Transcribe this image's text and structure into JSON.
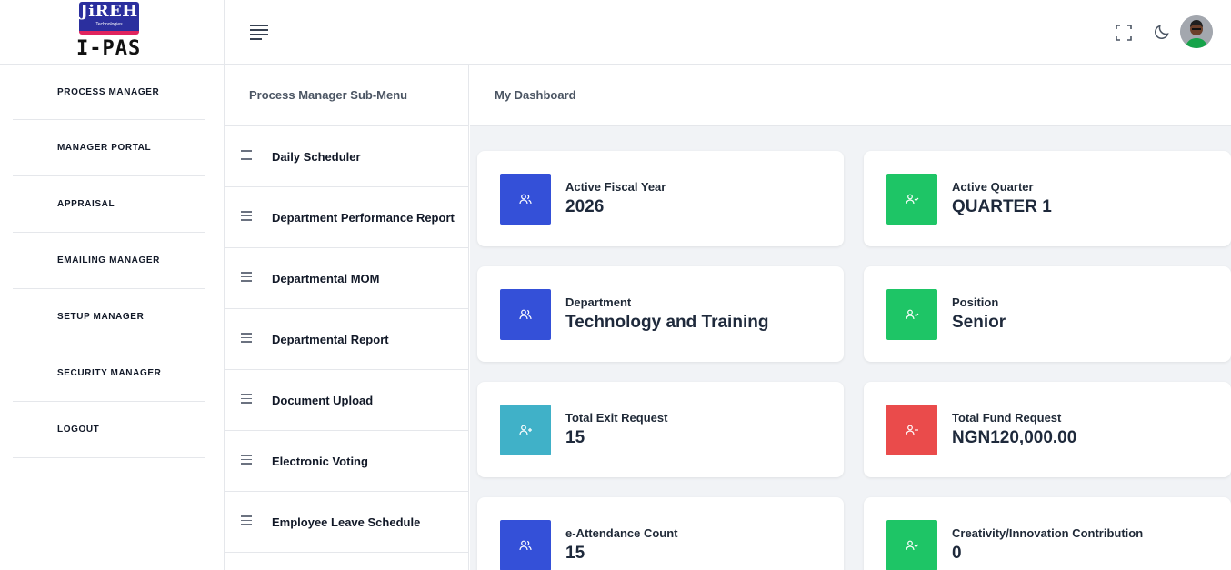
{
  "logo": {
    "brand": "JiREH",
    "tagline": "Technologies",
    "app_name": "I-PAS"
  },
  "sidebar": {
    "items": [
      {
        "label": "PROCESS MANAGER"
      },
      {
        "label": "MANAGER PORTAL"
      },
      {
        "label": "APPRAISAL"
      },
      {
        "label": "EMAILING MANAGER"
      },
      {
        "label": "SETUP MANAGER"
      },
      {
        "label": "SECURITY MANAGER"
      },
      {
        "label": "LOGOUT"
      }
    ]
  },
  "header": {
    "icons": [
      "menu-toggle-icon",
      "fullscreen-icon",
      "moon-icon",
      "avatar"
    ]
  },
  "submenu": {
    "title": "Process Manager Sub-Menu",
    "items": [
      {
        "label": "Daily Scheduler"
      },
      {
        "label": "Department Performance Report"
      },
      {
        "label": "Departmental MOM"
      },
      {
        "label": "Departmental Report"
      },
      {
        "label": "Document Upload"
      },
      {
        "label": "Electronic Voting"
      },
      {
        "label": "Employee Leave Schedule"
      }
    ]
  },
  "dashboard": {
    "title": "My Dashboard",
    "cards": [
      {
        "label": "Active Fiscal Year",
        "value": "2026",
        "color": "#3450d8",
        "icon": "users-icon"
      },
      {
        "label": "Active Quarter",
        "value": "QUARTER 1",
        "color": "#1ec566",
        "icon": "user-check-icon"
      },
      {
        "label": "Department",
        "value": "Technology and Training",
        "color": "#3450d8",
        "icon": "users-icon"
      },
      {
        "label": "Position",
        "value": "Senior",
        "color": "#1ec566",
        "icon": "user-check-icon"
      },
      {
        "label": "Total Exit Request",
        "value": "15",
        "color": "#40b1c8",
        "icon": "user-plus-icon"
      },
      {
        "label": "Total Fund Request",
        "value": "NGN120,000.00",
        "color": "#ea4b4b",
        "icon": "user-minus-icon"
      },
      {
        "label": "e-Attendance Count",
        "value": "15",
        "color": "#3450d8",
        "icon": "users-icon"
      },
      {
        "label": "Creativity/Innovation Contribution",
        "value": "0",
        "color": "#1ec566",
        "icon": "user-check-icon"
      }
    ]
  }
}
